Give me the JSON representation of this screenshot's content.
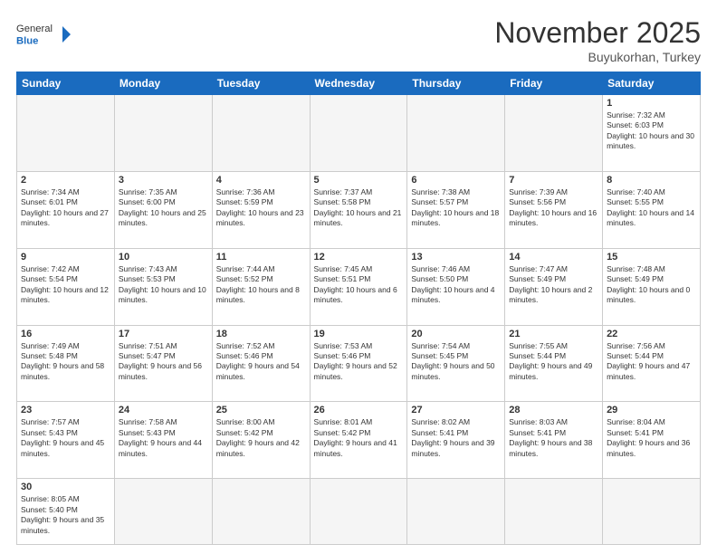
{
  "header": {
    "logo_general": "General",
    "logo_blue": "Blue",
    "month_title": "November 2025",
    "location": "Buyukorhan, Turkey"
  },
  "weekdays": [
    "Sunday",
    "Monday",
    "Tuesday",
    "Wednesday",
    "Thursday",
    "Friday",
    "Saturday"
  ],
  "weeks": [
    [
      {
        "day": "",
        "info": ""
      },
      {
        "day": "",
        "info": ""
      },
      {
        "day": "",
        "info": ""
      },
      {
        "day": "",
        "info": ""
      },
      {
        "day": "",
        "info": ""
      },
      {
        "day": "",
        "info": ""
      },
      {
        "day": "1",
        "info": "Sunrise: 7:32 AM\nSunset: 6:03 PM\nDaylight: 10 hours and 30 minutes."
      }
    ],
    [
      {
        "day": "2",
        "info": "Sunrise: 7:34 AM\nSunset: 6:01 PM\nDaylight: 10 hours and 27 minutes."
      },
      {
        "day": "3",
        "info": "Sunrise: 7:35 AM\nSunset: 6:00 PM\nDaylight: 10 hours and 25 minutes."
      },
      {
        "day": "4",
        "info": "Sunrise: 7:36 AM\nSunset: 5:59 PM\nDaylight: 10 hours and 23 minutes."
      },
      {
        "day": "5",
        "info": "Sunrise: 7:37 AM\nSunset: 5:58 PM\nDaylight: 10 hours and 21 minutes."
      },
      {
        "day": "6",
        "info": "Sunrise: 7:38 AM\nSunset: 5:57 PM\nDaylight: 10 hours and 18 minutes."
      },
      {
        "day": "7",
        "info": "Sunrise: 7:39 AM\nSunset: 5:56 PM\nDaylight: 10 hours and 16 minutes."
      },
      {
        "day": "8",
        "info": "Sunrise: 7:40 AM\nSunset: 5:55 PM\nDaylight: 10 hours and 14 minutes."
      }
    ],
    [
      {
        "day": "9",
        "info": "Sunrise: 7:42 AM\nSunset: 5:54 PM\nDaylight: 10 hours and 12 minutes."
      },
      {
        "day": "10",
        "info": "Sunrise: 7:43 AM\nSunset: 5:53 PM\nDaylight: 10 hours and 10 minutes."
      },
      {
        "day": "11",
        "info": "Sunrise: 7:44 AM\nSunset: 5:52 PM\nDaylight: 10 hours and 8 minutes."
      },
      {
        "day": "12",
        "info": "Sunrise: 7:45 AM\nSunset: 5:51 PM\nDaylight: 10 hours and 6 minutes."
      },
      {
        "day": "13",
        "info": "Sunrise: 7:46 AM\nSunset: 5:50 PM\nDaylight: 10 hours and 4 minutes."
      },
      {
        "day": "14",
        "info": "Sunrise: 7:47 AM\nSunset: 5:49 PM\nDaylight: 10 hours and 2 minutes."
      },
      {
        "day": "15",
        "info": "Sunrise: 7:48 AM\nSunset: 5:49 PM\nDaylight: 10 hours and 0 minutes."
      }
    ],
    [
      {
        "day": "16",
        "info": "Sunrise: 7:49 AM\nSunset: 5:48 PM\nDaylight: 9 hours and 58 minutes."
      },
      {
        "day": "17",
        "info": "Sunrise: 7:51 AM\nSunset: 5:47 PM\nDaylight: 9 hours and 56 minutes."
      },
      {
        "day": "18",
        "info": "Sunrise: 7:52 AM\nSunset: 5:46 PM\nDaylight: 9 hours and 54 minutes."
      },
      {
        "day": "19",
        "info": "Sunrise: 7:53 AM\nSunset: 5:46 PM\nDaylight: 9 hours and 52 minutes."
      },
      {
        "day": "20",
        "info": "Sunrise: 7:54 AM\nSunset: 5:45 PM\nDaylight: 9 hours and 50 minutes."
      },
      {
        "day": "21",
        "info": "Sunrise: 7:55 AM\nSunset: 5:44 PM\nDaylight: 9 hours and 49 minutes."
      },
      {
        "day": "22",
        "info": "Sunrise: 7:56 AM\nSunset: 5:44 PM\nDaylight: 9 hours and 47 minutes."
      }
    ],
    [
      {
        "day": "23",
        "info": "Sunrise: 7:57 AM\nSunset: 5:43 PM\nDaylight: 9 hours and 45 minutes."
      },
      {
        "day": "24",
        "info": "Sunrise: 7:58 AM\nSunset: 5:43 PM\nDaylight: 9 hours and 44 minutes."
      },
      {
        "day": "25",
        "info": "Sunrise: 8:00 AM\nSunset: 5:42 PM\nDaylight: 9 hours and 42 minutes."
      },
      {
        "day": "26",
        "info": "Sunrise: 8:01 AM\nSunset: 5:42 PM\nDaylight: 9 hours and 41 minutes."
      },
      {
        "day": "27",
        "info": "Sunrise: 8:02 AM\nSunset: 5:41 PM\nDaylight: 9 hours and 39 minutes."
      },
      {
        "day": "28",
        "info": "Sunrise: 8:03 AM\nSunset: 5:41 PM\nDaylight: 9 hours and 38 minutes."
      },
      {
        "day": "29",
        "info": "Sunrise: 8:04 AM\nSunset: 5:41 PM\nDaylight: 9 hours and 36 minutes."
      }
    ],
    [
      {
        "day": "30",
        "info": "Sunrise: 8:05 AM\nSunset: 5:40 PM\nDaylight: 9 hours and 35 minutes."
      },
      {
        "day": "",
        "info": ""
      },
      {
        "day": "",
        "info": ""
      },
      {
        "day": "",
        "info": ""
      },
      {
        "day": "",
        "info": ""
      },
      {
        "day": "",
        "info": ""
      },
      {
        "day": "",
        "info": ""
      }
    ]
  ]
}
